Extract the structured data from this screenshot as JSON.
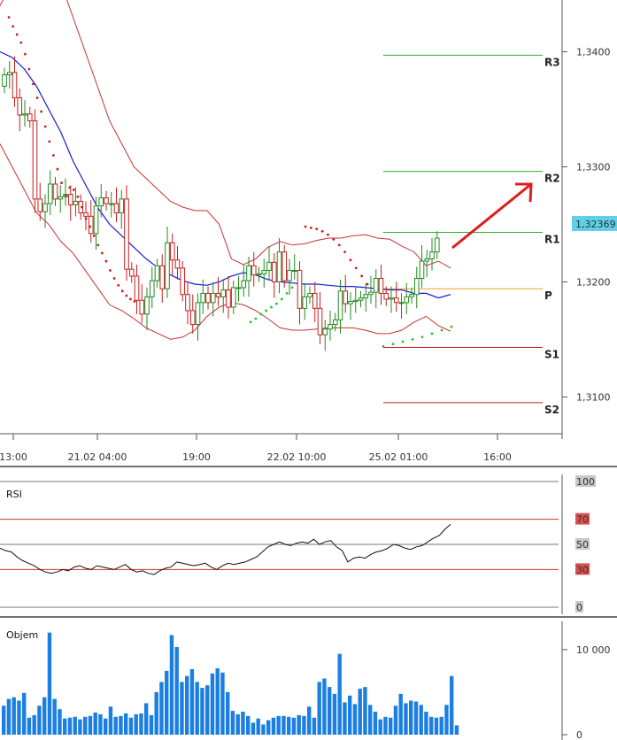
{
  "chart_data": [
    {
      "type": "candlestick",
      "panel": "price",
      "x_ticks": [
        "13:00",
        "21.02 04:00",
        "19:00",
        "22.02 10:00",
        "25.02 01:00",
        "16:00"
      ],
      "y_ticks": [
        "1,3400",
        "1,3300",
        "1,3200",
        "1,3100"
      ],
      "ylim": [
        1.3068,
        1.3445
      ],
      "current_price": "1,32369",
      "pivots": [
        {
          "label": "R3",
          "value": 1.3397,
          "color": "#29b529"
        },
        {
          "label": "R2",
          "value": 1.3296,
          "color": "#29b529"
        },
        {
          "label": "R1",
          "value": 1.3243,
          "color": "#29b529"
        },
        {
          "label": "P",
          "value": 1.3194,
          "color": "#f0a020"
        },
        {
          "label": "S1",
          "value": 1.3143,
          "color": "#c81e1e"
        },
        {
          "label": "S2",
          "value": 1.3095,
          "color": "#c81e1e"
        }
      ],
      "closes": [
        1.338,
        1.3382,
        1.336,
        1.3345,
        1.3346,
        1.334,
        1.3272,
        1.3261,
        1.3268,
        1.3285,
        1.3272,
        1.3274,
        1.3276,
        1.3267,
        1.327,
        1.326,
        1.3257,
        1.3242,
        1.3266,
        1.3273,
        1.3268,
        1.3268,
        1.326,
        1.3272,
        1.3211,
        1.3205,
        1.3184,
        1.3172,
        1.3187,
        1.3201,
        1.3214,
        1.3194,
        1.3234,
        1.3219,
        1.3212,
        1.3189,
        1.3175,
        1.3163,
        1.3182,
        1.319,
        1.3182,
        1.319,
        1.3187,
        1.3193,
        1.3178,
        1.3195,
        1.3195,
        1.3201,
        1.3214,
        1.3206,
        1.3207,
        1.321,
        1.3217,
        1.32,
        1.3226,
        1.3201,
        1.321,
        1.321,
        1.3177,
        1.3187,
        1.319,
        1.3177,
        1.3154,
        1.3159,
        1.3163,
        1.3167,
        1.3192,
        1.3181,
        1.3183,
        1.3184,
        1.3186,
        1.3189,
        1.3191,
        1.3203,
        1.319,
        1.3185,
        1.3186,
        1.3182,
        1.3182,
        1.3187,
        1.3189,
        1.3203,
        1.3218,
        1.322,
        1.3226,
        1.3238
      ],
      "upper_band": [
        1.344,
        1.346,
        1.348,
        1.349,
        1.348,
        1.346,
        1.343,
        1.34,
        1.337,
        1.334,
        1.332,
        1.33,
        1.329,
        1.328,
        1.327,
        1.3265,
        1.3262,
        1.3262,
        1.325,
        1.322,
        1.3215,
        1.322,
        1.323,
        1.3235,
        1.3232,
        1.3233,
        1.3236,
        1.3238,
        1.3238,
        1.324,
        1.3241,
        1.3238,
        1.3237,
        1.3231,
        1.3226,
        1.3214,
        1.3218,
        1.3212
      ],
      "lower_band": [
        1.332,
        1.33,
        1.328,
        1.326,
        1.325,
        1.3235,
        1.3225,
        1.321,
        1.3195,
        1.318,
        1.3175,
        1.3168,
        1.316,
        1.3155,
        1.315,
        1.3152,
        1.3158,
        1.317,
        1.3178,
        1.3182,
        1.318,
        1.3175,
        1.3168,
        1.316,
        1.3158,
        1.3158,
        1.3159,
        1.316,
        1.316,
        1.316,
        1.3158,
        1.3155,
        1.3155,
        1.3158,
        1.3165,
        1.317,
        1.3162,
        1.3157
      ],
      "moving_average": [
        1.34,
        1.3395,
        1.3385,
        1.337,
        1.335,
        1.333,
        1.3305,
        1.3285,
        1.3265,
        1.325,
        1.324,
        1.323,
        1.322,
        1.3212,
        1.3206,
        1.3201,
        1.3198,
        1.3197,
        1.32,
        1.3205,
        1.3208,
        1.3206,
        1.3202,
        1.32,
        1.3199,
        1.3198,
        1.3198,
        1.3197,
        1.3196,
        1.3196,
        1.3195,
        1.3194,
        1.3193,
        1.3193,
        1.319,
        1.319,
        1.3186,
        1.3189
      ]
    },
    {
      "type": "line",
      "panel": "rsi",
      "title": "RSI",
      "y_ticks": [
        "100",
        "70",
        "50",
        "30",
        "0"
      ],
      "levels": [
        {
          "value": 70,
          "color": "#d83030"
        },
        {
          "value": 30,
          "color": "#d83030"
        }
      ],
      "ylim": [
        0,
        100
      ],
      "values": [
        47,
        45,
        44,
        40,
        37,
        35,
        33,
        30,
        28,
        27,
        28,
        30,
        29,
        32,
        33,
        31,
        30,
        33,
        32,
        31,
        30,
        32,
        34,
        30,
        28,
        29,
        27,
        26,
        29,
        31,
        32,
        36,
        35,
        34,
        33,
        34,
        35,
        32,
        30,
        33,
        35,
        34,
        35,
        36,
        38,
        40,
        44,
        48,
        50,
        52,
        50,
        49,
        51,
        52,
        51,
        54,
        50,
        52,
        53,
        48,
        45,
        36,
        39,
        40,
        39,
        42,
        44,
        45,
        47,
        50,
        49,
        47,
        46,
        48,
        49,
        52,
        55,
        57,
        62,
        66
      ]
    },
    {
      "type": "bar",
      "panel": "volume",
      "title": "Objem",
      "y_ticks": [
        "10 000",
        "0"
      ],
      "ylim": [
        0,
        13000
      ],
      "values": [
        3400,
        4200,
        4400,
        4000,
        4900,
        2000,
        2300,
        3400,
        4400,
        12000,
        4200,
        3000,
        1900,
        2000,
        2100,
        1800,
        2100,
        2200,
        2600,
        2400,
        1900,
        3300,
        2100,
        2200,
        2500,
        2000,
        2400,
        2500,
        3700,
        2300,
        5000,
        6200,
        7500,
        11700,
        10300,
        6200,
        6900,
        7700,
        6200,
        5500,
        5800,
        7200,
        7800,
        7300,
        5000,
        2800,
        2400,
        2700,
        2200,
        1400,
        1900,
        1200,
        1700,
        2000,
        2200,
        2200,
        2100,
        2000,
        2300,
        2200,
        3300,
        2000,
        6200,
        6600,
        5600,
        4800,
        9500,
        3800,
        4600,
        3600,
        5400,
        5600,
        3500,
        2700,
        1800,
        2100,
        2000,
        3400,
        4800,
        3700,
        4000,
        3900,
        3500,
        2700,
        2100,
        2000,
        2100,
        3500,
        6900,
        1100
      ]
    }
  ]
}
